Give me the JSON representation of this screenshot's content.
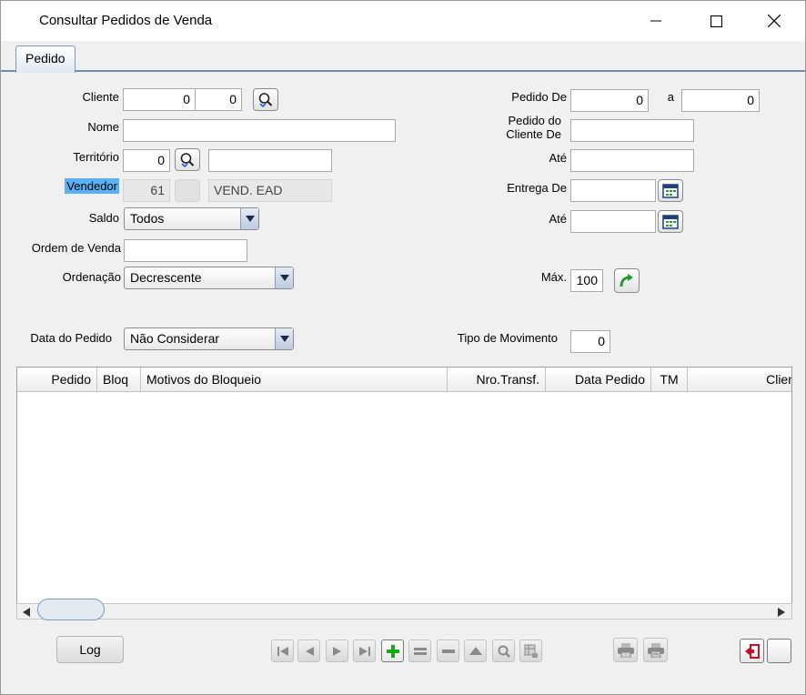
{
  "window": {
    "title": "Consultar Pedidos de Venda"
  },
  "tabs": [
    {
      "label": "Pedido"
    }
  ],
  "form": {
    "cliente": {
      "label": "Cliente",
      "code": "0",
      "sub": "0"
    },
    "nome": {
      "label": "Nome",
      "value": ""
    },
    "territorio": {
      "label": "Território",
      "code": "0",
      "desc": ""
    },
    "vendedor": {
      "label": "Vendedor",
      "code": "61",
      "desc": "VEND. EAD"
    },
    "saldo": {
      "label": "Saldo",
      "value": "Todos"
    },
    "ordem_venda": {
      "label": "Ordem de Venda",
      "value": ""
    },
    "ordenacao": {
      "label": "Ordenação",
      "value": "Decrescente"
    },
    "data_pedido": {
      "label": "Data do Pedido",
      "value": "Não Considerar"
    },
    "pedido_de": {
      "label": "Pedido De",
      "from": "0",
      "to_label": "a",
      "to": "0"
    },
    "pedido_cliente_de": {
      "label_line1": "Pedido do",
      "label_line2": "Cliente De",
      "value": ""
    },
    "ate1": {
      "label": "Até",
      "value": ""
    },
    "entrega_de": {
      "label": "Entrega De",
      "value": ""
    },
    "ate2": {
      "label": "Até",
      "value": ""
    },
    "max": {
      "label": "Máx.",
      "value": "100"
    },
    "tipo_movimento": {
      "label": "Tipo de Movimento",
      "value": "0"
    }
  },
  "grid": {
    "columns": [
      "Pedido",
      "Bloq",
      "Motivos do Bloqueio",
      "Nro.Transf.",
      "Data Pedido",
      "TM",
      "Clien"
    ]
  },
  "footer": {
    "log_label": "Log"
  },
  "colors": {
    "tab_border": "#6d8db3",
    "highlight": "#5ab0f2",
    "add_green": "#1aa81a",
    "refresh_green": "#1f9a2e",
    "exit_red": "#c8102e"
  }
}
